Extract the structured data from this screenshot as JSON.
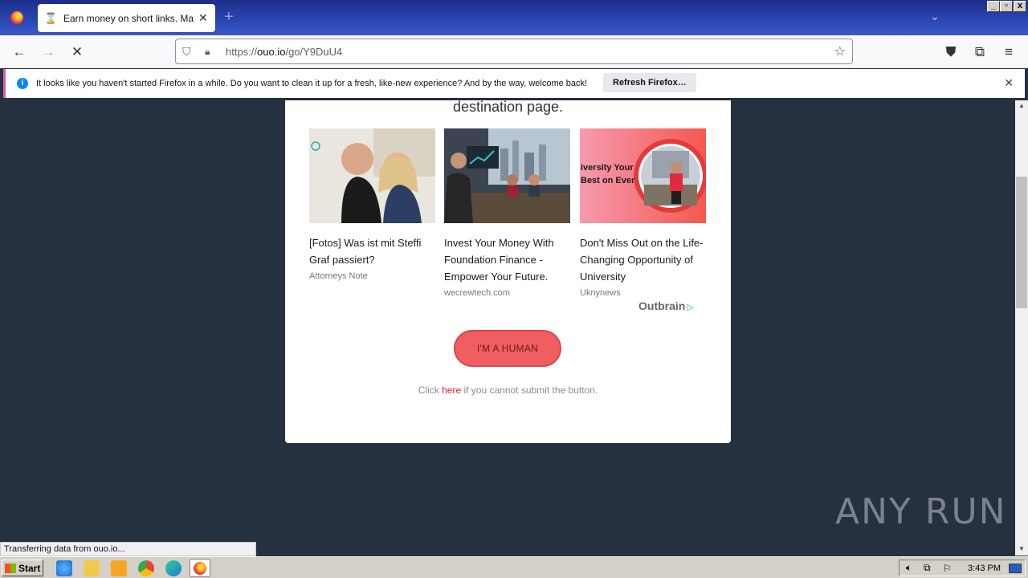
{
  "browser": {
    "tab_title": "Earn money on short links. Make s",
    "url_host": "ouo.io",
    "url_prefix": "https://",
    "url_path": "/go/Y9DuU4",
    "notification_text": "It looks like you haven't started Firefox in a while. Do you want to clean it up for a fresh, like-new experience? And by the way, welcome back!",
    "notification_button": "Refresh Firefox…"
  },
  "page": {
    "destination_text": "destination page.",
    "ads": [
      {
        "headline": "[Fotos] Was ist mit Steffi Graf passiert?",
        "source": "Attorneys Note"
      },
      {
        "headline": "Invest Your Money With Foundation Finance - Empower Your Future.",
        "source": "wecrewtech.com"
      },
      {
        "headline": "Don't Miss Out on the Life-Changing Opportunity of University",
        "source": "Uknynews"
      }
    ],
    "ad3_banner_text": "iversity Your Best on Ever",
    "outbrain_label": "Outbrain",
    "human_button": "I'M A HUMAN",
    "click_prefix": "Click ",
    "click_link": "here",
    "click_suffix": " if you cannot submit the button."
  },
  "status": {
    "transfer_text": "Transferring data from ouo.io..."
  },
  "watermark": "ANY RUN",
  "taskbar": {
    "start_label": "Start",
    "clock": "3:43 PM"
  },
  "icons": {
    "tab": "hourglass-icon",
    "close": "close-icon",
    "back": "back-arrow-icon",
    "forward": "forward-arrow-icon",
    "stop": "stop-icon",
    "shield": "shield-icon",
    "lock": "lock-icon",
    "bookmark": "star-icon",
    "pocket": "pocket-icon",
    "extensions": "puzzle-icon",
    "menu": "hamburger-menu-icon"
  },
  "colors": {
    "page_bg": "#253040",
    "button_red": "#ef5e61",
    "link_red": "#d9262c"
  }
}
